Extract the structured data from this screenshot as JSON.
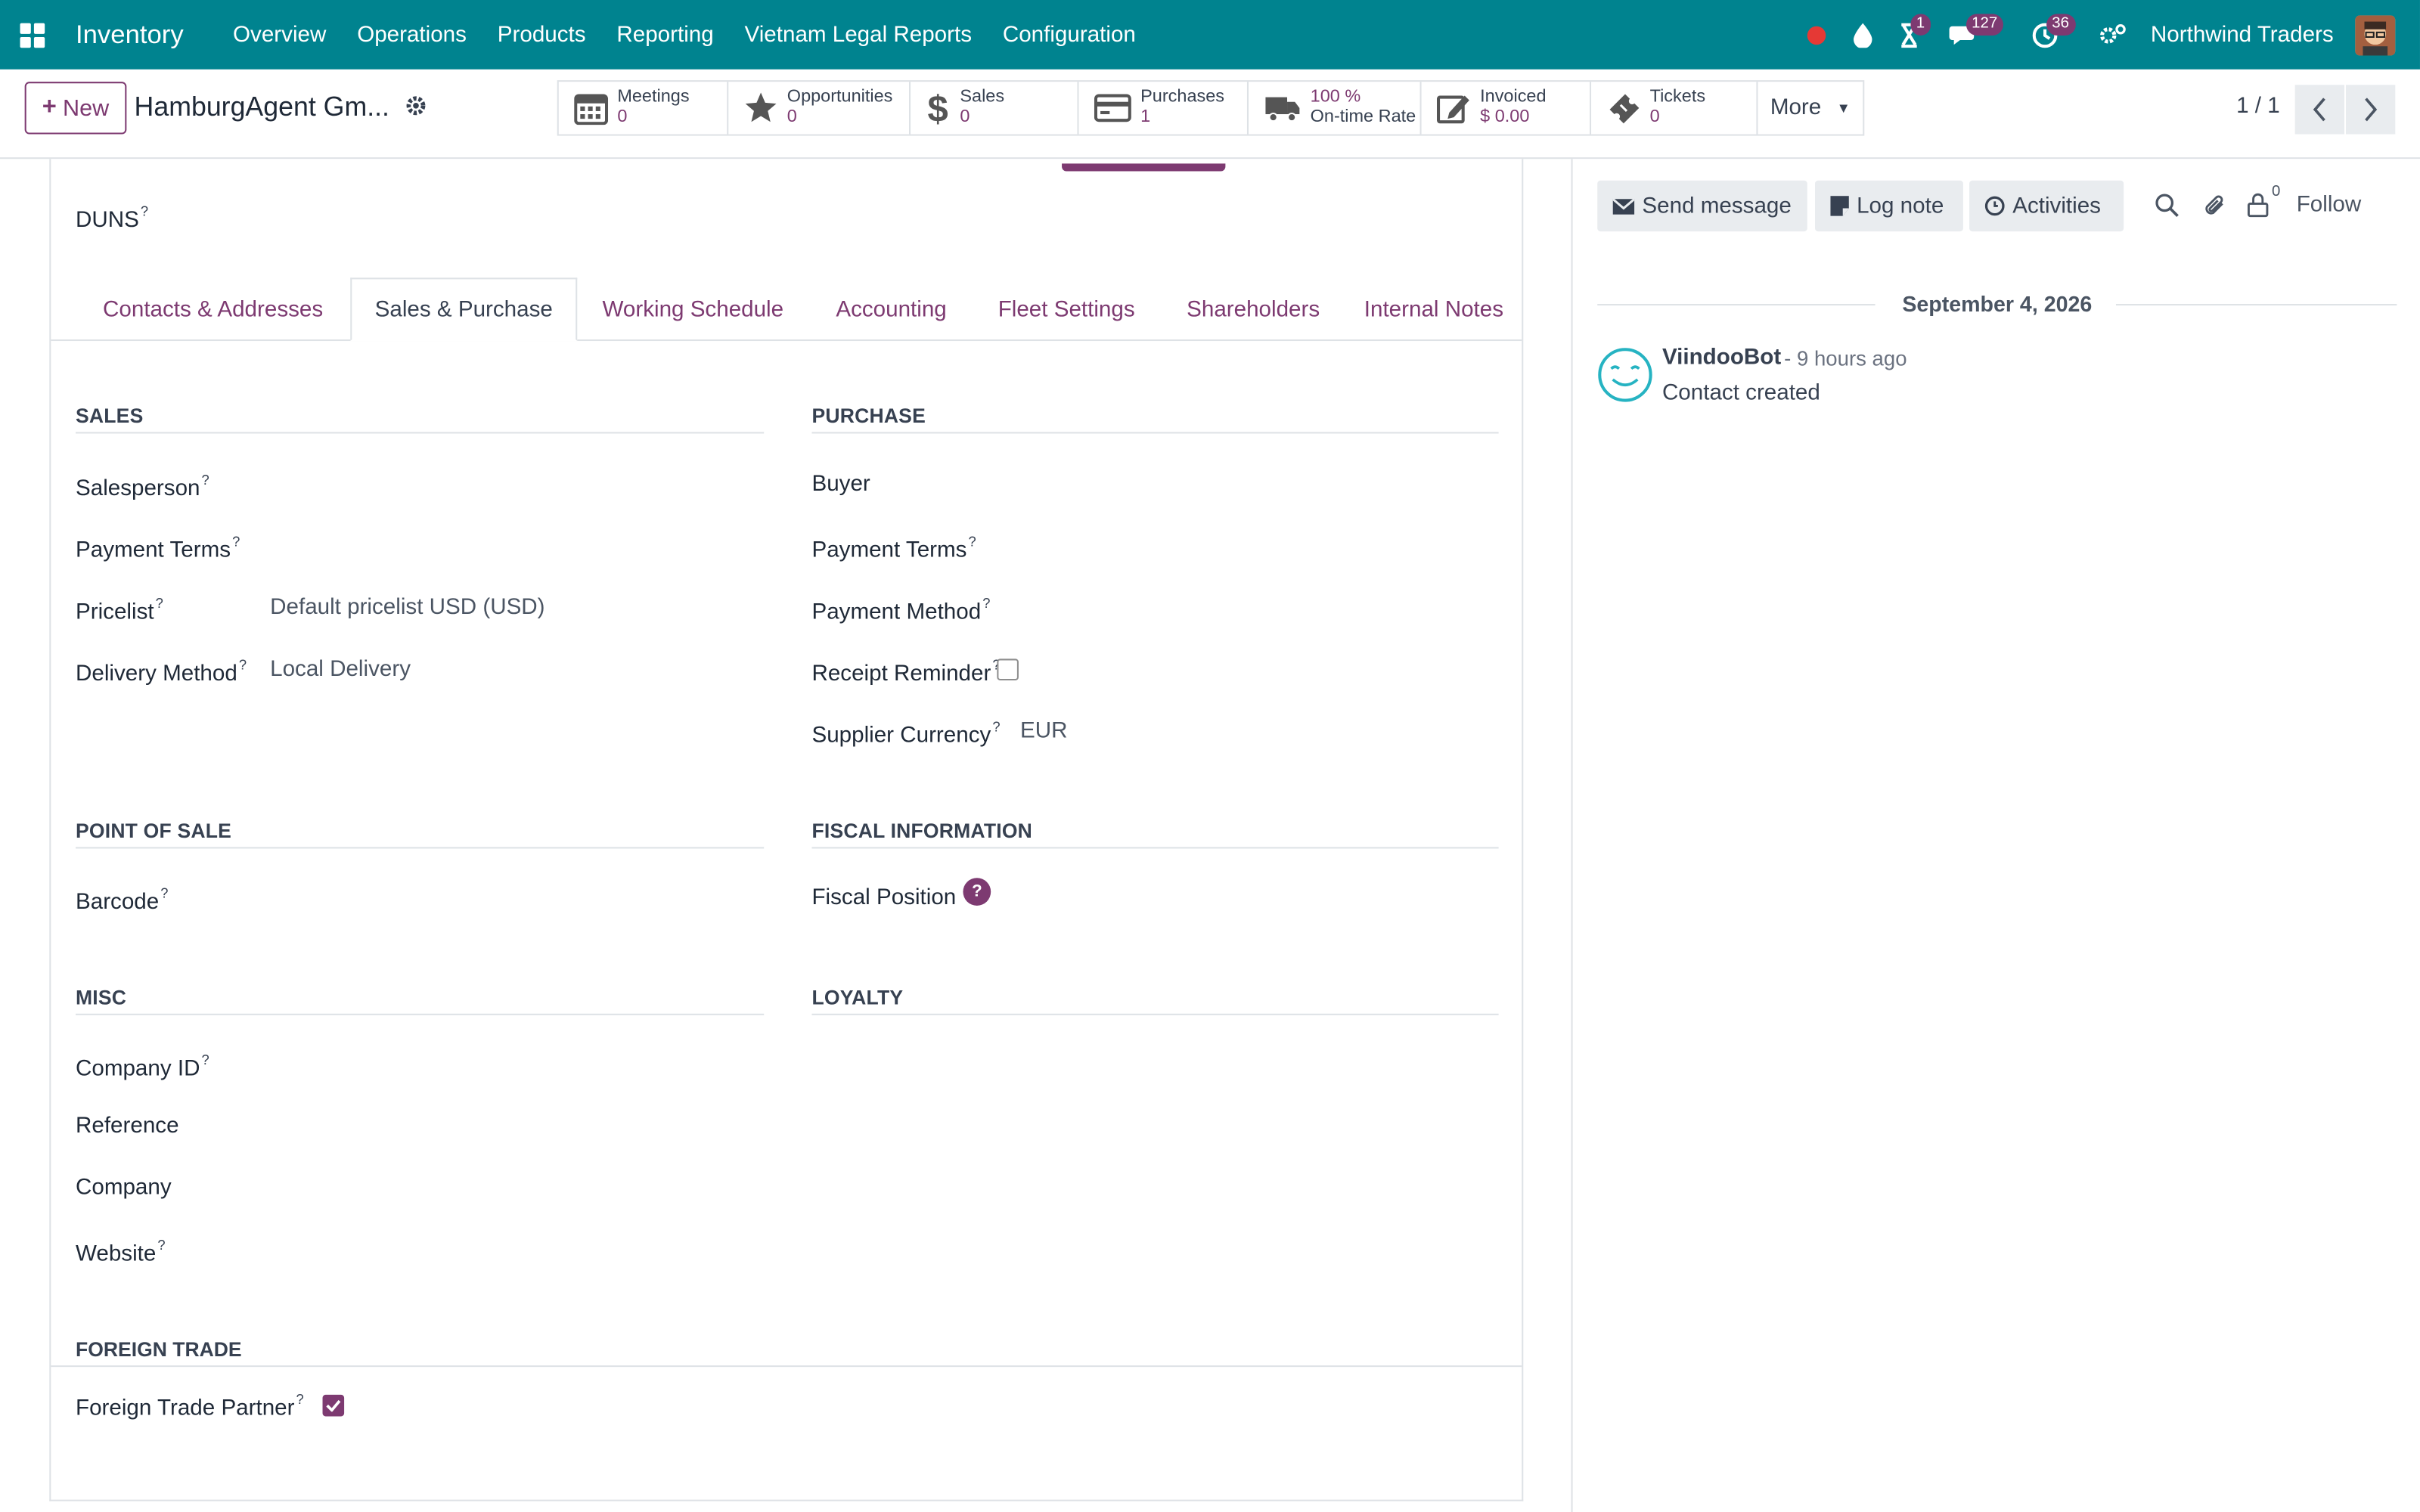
{
  "navbar": {
    "brand": "Inventory",
    "menu": [
      "Overview",
      "Operations",
      "Products",
      "Reporting",
      "Vietnam Legal Reports",
      "Configuration"
    ],
    "activity_badge": "1",
    "messages_badge": "127",
    "timer_badge": "36",
    "company": "Northwind Traders"
  },
  "control": {
    "new_label": "New",
    "record_title": "HamburgAgent Gm...",
    "smart_buttons": [
      {
        "label": "Meetings",
        "value": "0",
        "icon": "calendar-icon"
      },
      {
        "label": "Opportunities",
        "value": "0",
        "icon": "star-icon"
      },
      {
        "label": "Sales",
        "value": "0",
        "icon": "dollar-icon"
      },
      {
        "label": "Purchases",
        "value": "1",
        "icon": "credit-card-icon"
      },
      {
        "label": "100  %",
        "value": "On-time Rate",
        "icon": "truck-icon"
      },
      {
        "label": "Invoiced",
        "value": "$ 0.00",
        "icon": "pencil-square-icon"
      },
      {
        "label": "Tickets",
        "value": "0",
        "icon": "ticket-icon"
      }
    ],
    "more_label": "More",
    "pager": "1 / 1"
  },
  "form": {
    "duns_label": "DUNS",
    "tabs": [
      "Contacts & Addresses",
      "Sales & Purchase",
      "Working Schedule",
      "Accounting",
      "Fleet Settings",
      "Shareholders",
      "Internal Notes"
    ],
    "sales": {
      "title": "SALES",
      "salesperson": "Salesperson",
      "payment_terms": "Payment Terms",
      "pricelist": "Pricelist",
      "pricelist_value": "Default pricelist USD  (USD)",
      "delivery_method": "Delivery Method",
      "delivery_method_value": "Local Delivery"
    },
    "purchase": {
      "title": "PURCHASE",
      "buyer": "Buyer",
      "payment_terms": "Payment Terms",
      "payment_method": "Payment Method",
      "receipt_reminder": "Receipt Reminder",
      "supplier_currency": "Supplier Currency",
      "supplier_currency_value": "EUR"
    },
    "pos": {
      "title": "POINT OF SALE",
      "barcode": "Barcode"
    },
    "fiscal": {
      "title": "FISCAL INFORMATION",
      "fiscal_position": "Fiscal Position"
    },
    "misc": {
      "title": "MISC",
      "company_id": "Company ID",
      "reference": "Reference",
      "company": "Company",
      "website": "Website"
    },
    "loyalty": {
      "title": "LOYALTY"
    },
    "foreign_trade": {
      "title": "FOREIGN TRADE",
      "partner": "Foreign Trade Partner"
    }
  },
  "chatter": {
    "send_message": "Send message",
    "log_note": "Log note",
    "activities": "Activities",
    "followers_count": "0",
    "follow": "Follow",
    "date": "September 4, 2026",
    "author": "ViindooBot",
    "time": "- 9 hours ago",
    "body": "Contact created"
  },
  "colors": {
    "navbar": "#00838f",
    "accent": "#7d3a71"
  }
}
